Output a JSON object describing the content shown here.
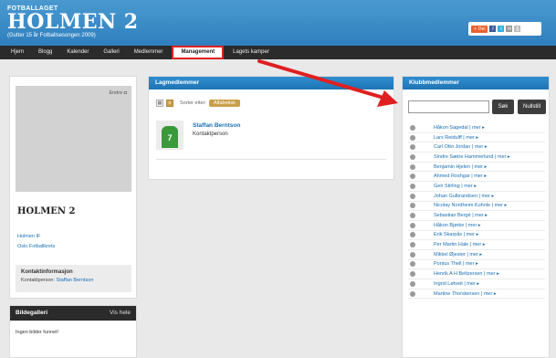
{
  "header": {
    "brand_top": "FOTBALLAGET",
    "brand_main": "HOLMEN 2",
    "brand_sub": "(Gutter 15 år Fotballsesongen 2009)",
    "share_label": "Del"
  },
  "nav": {
    "items": [
      {
        "label": "Hjem"
      },
      {
        "label": "Blogg"
      },
      {
        "label": "Kalender"
      },
      {
        "label": "Galleri"
      },
      {
        "label": "Medlemmer"
      },
      {
        "label": "Management",
        "active": true
      },
      {
        "label": "Lagets kamper"
      }
    ]
  },
  "left": {
    "edit_label": "Endre",
    "team_name": "HOLMEN 2",
    "links": [
      "Holmen IF",
      "Oslo Fotballkrets"
    ],
    "contact_title": "Kontaktinformasjon",
    "contact_label": "Kontaktperson:",
    "contact_name": "Staffan Berntson"
  },
  "gallery": {
    "title": "Bildegalleri",
    "see_all": "Vis hele",
    "empty_text": "Ingen bilder funnet!"
  },
  "team_members": {
    "title": "Lagmedlemmer",
    "sort_label": "Sorter etter:",
    "sort_value": "Alfabetisk",
    "member": {
      "name": "Staffan Berntson",
      "role": "Kontaktperson",
      "shirt_number": "7"
    }
  },
  "club_members": {
    "title": "Klubbmedlemmer",
    "search_placeholder": "",
    "search_button": "Søk",
    "reset_button": "Nullstill",
    "members": [
      "Håkon Sagedal | mer ▸",
      "Lars Reidulff | mer ▸",
      "Carl Otto Jordan | mer ▸",
      "Sindre Sætre Hammerlund | mer ▸",
      "Benjamin Hjelen | mer ▸",
      "Ahmed Roshgar | mer ▸",
      "Geir Stirling | mer ▸",
      "Johan Gulbrandsen | mer ▸",
      "Nicolay Nordheim Kuhnle | mer ▸",
      "Sebastian Bergé | mer ▸",
      "Håkon Bjørke | mer ▸",
      "Erik Skarpås | mer ▸",
      "Per Martin Hale | mer ▸",
      "Mikkel Øjester | mer ▸",
      "Pontus Thell | mer ▸",
      "Henrik A H Beltzersen | mer ▸",
      "Ingrid Løtveit | mer ▸",
      "Martine Thorstensen | mer ▸"
    ]
  },
  "colors": {
    "header_blue": "#2f7fbf",
    "nav_dark": "#2b2b2b",
    "link_blue": "#1a6fb5",
    "highlight_red": "#e02020",
    "sort_gold": "#c9a04a"
  }
}
